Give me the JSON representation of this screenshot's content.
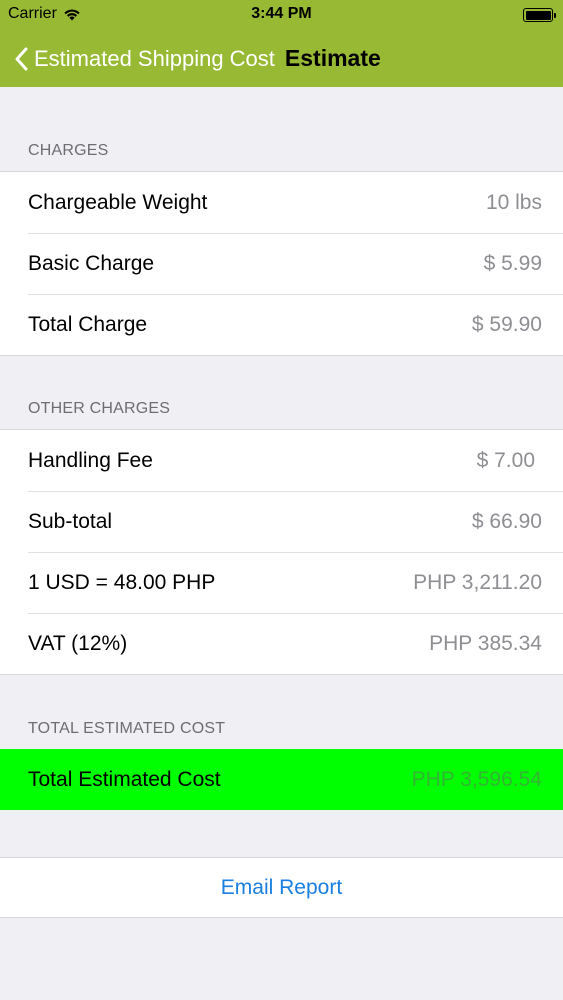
{
  "status_bar": {
    "carrier": "Carrier",
    "time": "3:44 PM"
  },
  "navbar": {
    "back_label": "Estimated Shipping Cost",
    "title": "Estimate",
    "color": "#97b933"
  },
  "charges": {
    "header": "CHARGES",
    "rows": [
      {
        "label": "Chargeable Weight",
        "value": "10 lbs"
      },
      {
        "label": "Basic Charge",
        "value": "$ 5.99"
      },
      {
        "label": "Total Charge",
        "value": "$ 59.90"
      }
    ]
  },
  "other_charges": {
    "header": "OTHER CHARGES",
    "rows": [
      {
        "label": "Handling Fee",
        "value": "$ 7.00"
      },
      {
        "label": "Sub-total",
        "value": "$ 66.90"
      },
      {
        "label": "1 USD = 48.00 PHP",
        "value": "PHP 3,211.20"
      },
      {
        "label": "VAT (12%)",
        "value": "PHP 385.34"
      }
    ]
  },
  "total": {
    "header": "TOTAL ESTIMATED COST",
    "label": "Total Estimated Cost",
    "value": "PHP 3,596.54",
    "highlight_color": "#00ff00"
  },
  "actions": {
    "email_report": "Email Report"
  }
}
